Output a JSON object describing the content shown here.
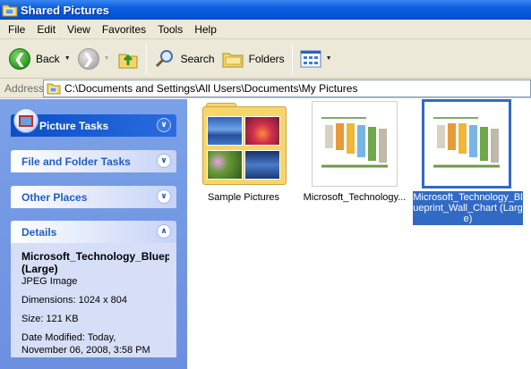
{
  "window": {
    "title": "Shared Pictures"
  },
  "menu": [
    "File",
    "Edit",
    "View",
    "Favorites",
    "Tools",
    "Help"
  ],
  "toolbar": {
    "back_label": "Back",
    "search_label": "Search",
    "folders_label": "Folders"
  },
  "address": {
    "label": "Address",
    "path": "C:\\Documents and Settings\\All Users\\Documents\\My Pictures"
  },
  "tasks": {
    "picture_tasks": "Picture Tasks",
    "file_folder_tasks": "File and Folder Tasks",
    "other_places": "Other Places",
    "details": "Details"
  },
  "details": {
    "name_line1": "Microsoft_Technology_Bluep",
    "name_line2": "(Large)",
    "type": "JPEG Image",
    "dimensions": "Dimensions: 1024 x 804",
    "size": "Size: 121 KB",
    "modified_line1": "Date Modified: Today,",
    "modified_line2": "November 06, 2008, 3:58 PM"
  },
  "items": [
    {
      "label": "Sample Pictures"
    },
    {
      "label": "Microsoft_Technology..."
    },
    {
      "label": "Microsoft_Technology_Blueprint_Wall_Chart (Large)"
    }
  ],
  "colors": {
    "title_bar": "#0553d8",
    "task_pane": "#7ba1e8",
    "selection": "#316ac5"
  }
}
